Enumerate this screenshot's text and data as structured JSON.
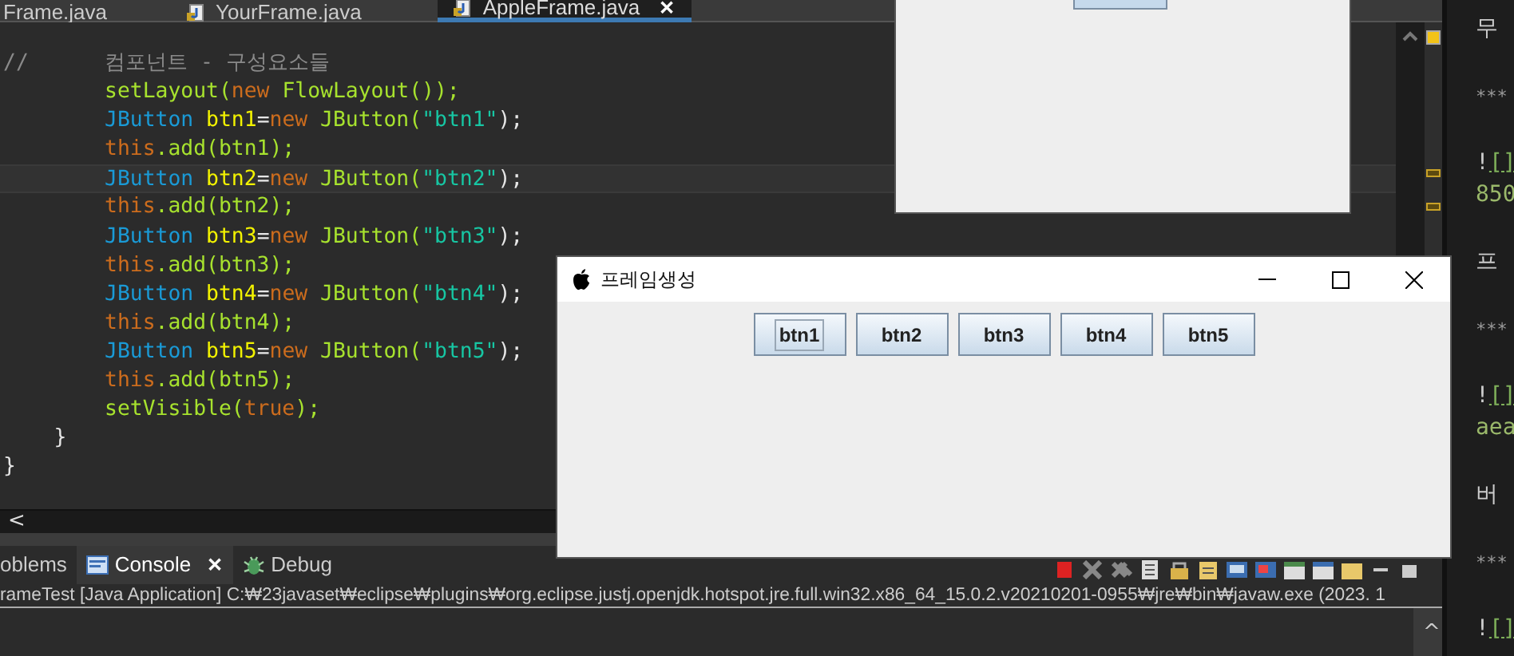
{
  "editor_tabs": [
    {
      "label": "Frame.java",
      "selected": false
    },
    {
      "label": "YourFrame.java",
      "selected": false
    },
    {
      "label": "AppleFrame.java",
      "selected": true,
      "close_label": "✕"
    }
  ],
  "code_lines": [
    {
      "current": false,
      "tokens": [
        {
          "text": "//      컴포넌트 - 구성요소들",
          "kind": "comment"
        }
      ]
    },
    {
      "current": false,
      "tokens": [
        {
          "text": "        setLayout(",
          "kind": "method"
        },
        {
          "text": "new ",
          "kind": "keyword"
        },
        {
          "text": "FlowLayout());",
          "kind": "method"
        }
      ]
    },
    {
      "current": false,
      "tokens": [
        {
          "text": "        JButton ",
          "kind": "type"
        },
        {
          "text": "btn1",
          "kind": "variable"
        },
        {
          "text": "=",
          "kind": "plain"
        },
        {
          "text": "new ",
          "kind": "keyword"
        },
        {
          "text": "JButton(",
          "kind": "method"
        },
        {
          "text": "\"btn1\"",
          "kind": "string"
        },
        {
          "text": ");",
          "kind": "plain"
        }
      ]
    },
    {
      "current": false,
      "tokens": [
        {
          "text": "        this",
          "kind": "keyword"
        },
        {
          "text": ".add(btn1);",
          "kind": "method"
        }
      ]
    },
    {
      "current": true,
      "tokens": [
        {
          "text": "        JButton ",
          "kind": "type"
        },
        {
          "text": "btn2",
          "kind": "variable"
        },
        {
          "text": "=",
          "kind": "plain"
        },
        {
          "text": "new ",
          "kind": "keyword"
        },
        {
          "text": "JButton(",
          "kind": "method"
        },
        {
          "text": "\"btn2\"",
          "kind": "string"
        },
        {
          "text": ");",
          "kind": "plain"
        }
      ]
    },
    {
      "current": false,
      "tokens": [
        {
          "text": "        this",
          "kind": "keyword"
        },
        {
          "text": ".add(btn2);",
          "kind": "method"
        }
      ]
    },
    {
      "current": false,
      "tokens": [
        {
          "text": "        JButton ",
          "kind": "type"
        },
        {
          "text": "btn3",
          "kind": "variable"
        },
        {
          "text": "=",
          "kind": "plain"
        },
        {
          "text": "new ",
          "kind": "keyword"
        },
        {
          "text": "JButton(",
          "kind": "method"
        },
        {
          "text": "\"btn3\"",
          "kind": "string"
        },
        {
          "text": ");",
          "kind": "plain"
        }
      ]
    },
    {
      "current": false,
      "tokens": [
        {
          "text": "        this",
          "kind": "keyword"
        },
        {
          "text": ".add(btn3);",
          "kind": "method"
        }
      ]
    },
    {
      "current": false,
      "tokens": [
        {
          "text": "        JButton ",
          "kind": "type"
        },
        {
          "text": "btn4",
          "kind": "variable"
        },
        {
          "text": "=",
          "kind": "plain"
        },
        {
          "text": "new ",
          "kind": "keyword"
        },
        {
          "text": "JButton(",
          "kind": "method"
        },
        {
          "text": "\"btn4\"",
          "kind": "string"
        },
        {
          "text": ");",
          "kind": "plain"
        }
      ]
    },
    {
      "current": false,
      "tokens": [
        {
          "text": "        this",
          "kind": "keyword"
        },
        {
          "text": ".add(btn4);",
          "kind": "method"
        }
      ]
    },
    {
      "current": false,
      "tokens": [
        {
          "text": "        JButton ",
          "kind": "type"
        },
        {
          "text": "btn5",
          "kind": "variable"
        },
        {
          "text": "=",
          "kind": "plain"
        },
        {
          "text": "new ",
          "kind": "keyword"
        },
        {
          "text": "JButton(",
          "kind": "method"
        },
        {
          "text": "\"btn5\"",
          "kind": "string"
        },
        {
          "text": ");",
          "kind": "plain"
        }
      ]
    },
    {
      "current": false,
      "tokens": [
        {
          "text": "        this",
          "kind": "keyword"
        },
        {
          "text": ".add(btn5);",
          "kind": "method"
        }
      ]
    },
    {
      "current": false,
      "tokens": [
        {
          "text": "        setVisible(",
          "kind": "method"
        },
        {
          "text": "true",
          "kind": "keyword"
        },
        {
          "text": ");",
          "kind": "method"
        }
      ]
    },
    {
      "current": false,
      "tokens": [
        {
          "text": "    }",
          "kind": "plain"
        }
      ]
    },
    {
      "current": false,
      "tokens": [
        {
          "text": "}",
          "kind": "plain"
        }
      ]
    }
  ],
  "hscroll_arrow": "<",
  "console_tabs": [
    {
      "label": "oblems",
      "selected": false
    },
    {
      "label": "Console",
      "selected": true,
      "close_label": "✕"
    },
    {
      "label": "Debug",
      "selected": false
    }
  ],
  "console_status": "rameTest [Java Application] C:₩23javaset₩eclipse₩plugins₩org.eclipse.justj.openjdk.hotspot.jre.full.win32.x86_64_15.0.2.v20210201-0955₩jre₩bin₩javaw.exe  (2023. 1",
  "console_scroll_arrow": "^",
  "markdown": [
    [
      {
        "parts": [
          {
            "text": "무",
            "kind": "plain"
          }
        ]
      }
    ],
    [
      {
        "parts": [
          {
            "text": "***",
            "kind": "rule"
          }
        ]
      }
    ],
    [
      {
        "parts": [
          {
            "text": "!",
            "kind": "plain"
          },
          {
            "text": "[]",
            "kind": "link"
          }
        ]
      },
      {
        "parts": [
          {
            "text": "850",
            "kind": "url"
          }
        ]
      }
    ],
    [
      {
        "parts": [
          {
            "text": "프",
            "kind": "plain"
          }
        ]
      }
    ],
    [
      {
        "parts": [
          {
            "text": "***",
            "kind": "rule"
          }
        ]
      }
    ],
    [
      {
        "parts": [
          {
            "text": "!",
            "kind": "plain"
          },
          {
            "text": "[]",
            "kind": "link"
          }
        ]
      },
      {
        "parts": [
          {
            "text": "aea",
            "kind": "url"
          }
        ]
      }
    ],
    [
      {
        "parts": [
          {
            "text": "버",
            "kind": "plain"
          }
        ]
      }
    ],
    [
      {
        "parts": [
          {
            "text": "***",
            "kind": "rule"
          }
        ]
      }
    ],
    [
      {
        "parts": [
          {
            "text": "!",
            "kind": "plain"
          },
          {
            "text": "[]",
            "kind": "link"
          }
        ]
      }
    ]
  ],
  "frame_window": {
    "title": "프레임생성",
    "controls": [
      {
        "kind": "minimize"
      },
      {
        "kind": "maximize"
      },
      {
        "kind": "close"
      }
    ],
    "buttons": [
      {
        "label": "btn1",
        "focused": true
      },
      {
        "label": "btn2",
        "focused": false
      },
      {
        "label": "btn3",
        "focused": false
      },
      {
        "label": "btn4",
        "focused": false
      },
      {
        "label": "btn5",
        "focused": false
      }
    ]
  }
}
